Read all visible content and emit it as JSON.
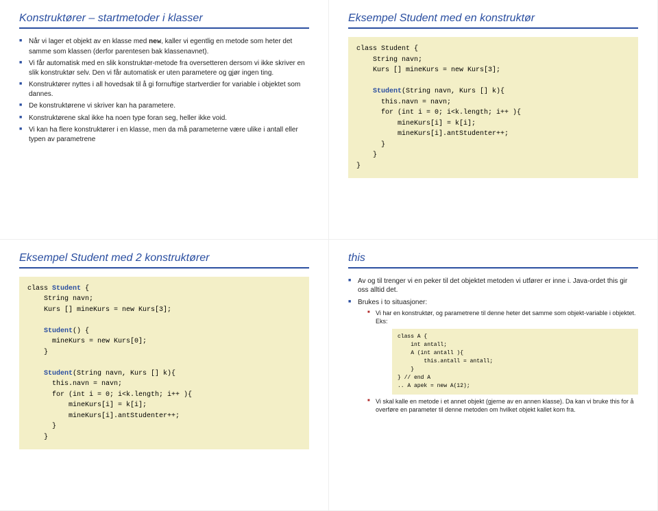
{
  "slide1": {
    "title": "Konstruktører – startmetoder i klasser",
    "bullets": [
      "Når vi lager et objekt av en klasse med new, kaller vi egentlig en metode som heter det samme som klassen (derfor parentesen bak klassenavnet).",
      "Vi får automatisk med en slik konstruktør-metode fra oversetteren dersom vi ikke skriver en slik konstruktør selv. Den vi får automatisk er uten parametere og gjør ingen ting.",
      "Konstruktører nyttes i all hovedsak til å gi fornuftige startverdier for variable i objektet som dannes.",
      "De konstruktørene vi skriver kan ha parametere.",
      "Konstruktørene skal ikke ha noen type foran seg, heller ikke void.",
      "Vi kan ha flere konstruktører i en klasse, men da må parameterne være ulike i antall eller typen av parametrene"
    ]
  },
  "slide2": {
    "title": "Eksempel Student med en konstruktør",
    "code": "class Student {\n    String navn;\n    Kurs [] mineKurs = new Kurs[3];\n\n    Student(String navn, Kurs [] k){\n      this.navn = navn;\n      for (int i = 0; i<k.length; i++ ){\n          mineKurs[i] = k[i];\n          mineKurs[i].antStudenter++;\n      }\n    }\n}"
  },
  "slide3": {
    "title": "Eksempel Student med 2 konstruktører",
    "code": "class Student {\n    String navn;\n    Kurs [] mineKurs = new Kurs[3];\n\n    Student() {\n      mineKurs = new Kurs[0];\n    }\n\n    Student(String navn, Kurs [] k){\n      this.navn = navn;\n      for (int i = 0; i<k.length; i++ ){\n          mineKurs[i] = k[i];\n          mineKurs[i].antStudenter++;\n      }\n    }"
  },
  "slide4": {
    "title": "this",
    "bullets": {
      "b1": "Av og til trenger vi en peker til det objektet metoden vi utfører er inne i. Java-ordet this gir oss alltid det.",
      "b2": "Brukes i to situasjoner:",
      "b2a": "Vi har en konstruktør, og parametrene til denne heter det samme som objekt-variable i objektet. Eks:",
      "b2b": "Vi skal kalle en metode i et annet objekt (gjerne av en annen klasse). Da kan vi bruke this for å overføre en parameter til denne metoden om hvilket objekt kallet kom fra."
    },
    "code": "class A {\n    int antall;\n    A (int antall ){\n        this.antall = antall;\n    }\n} // end A\n.. A apek = new A(12);"
  }
}
